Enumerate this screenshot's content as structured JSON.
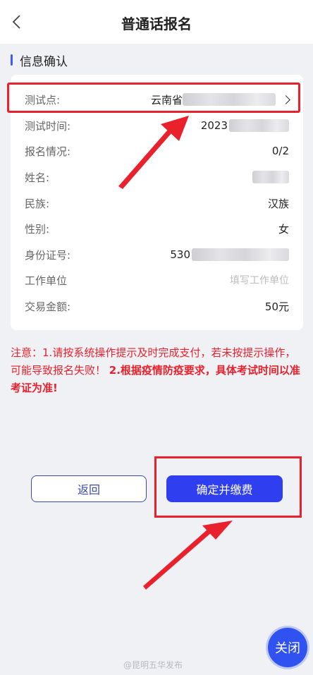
{
  "header": {
    "title": "普通话报名"
  },
  "section": {
    "title": "信息确认"
  },
  "rows": [
    {
      "label": "测试点:",
      "value": "云南省"
    },
    {
      "label": "测试时间:",
      "value": "2023"
    },
    {
      "label": "报名情况:",
      "value": "0/2"
    },
    {
      "label": "姓名:",
      "value": ""
    },
    {
      "label": "民族:",
      "value": "汉族"
    },
    {
      "label": "性别:",
      "value": "女"
    },
    {
      "label": "身份证号:",
      "value": "530"
    },
    {
      "label": "工作单位",
      "placeholder": "填写工作单位"
    },
    {
      "label": "交易金额:",
      "value": "50元"
    }
  ],
  "notice": {
    "prefix": "注意：",
    "text1": "1.请按系统操作提示及时完成支付，若未按提示操作，可能导致报名失败！ ",
    "text2": "2.根据疫情防疫要求，具体考试时间以准考证为准!"
  },
  "buttons": {
    "back": "返回",
    "confirm": "确定并缴费"
  },
  "fab": {
    "close": "关闭"
  },
  "watermark": "@昆明五华发布",
  "colors": {
    "accent": "#2f3ff0",
    "highlight": "#e8212c"
  },
  "icons": {
    "back": "chevron-left-icon",
    "detail": "chevron-right-icon"
  }
}
